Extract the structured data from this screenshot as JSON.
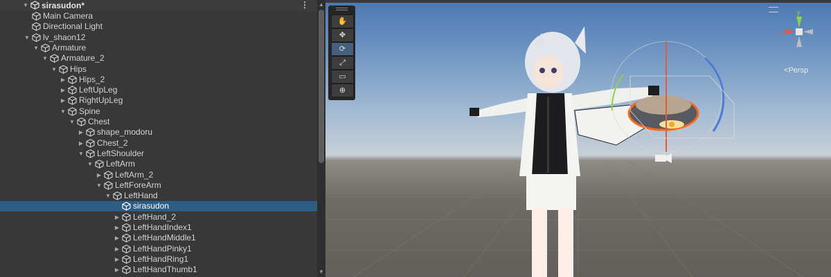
{
  "hierarchy": {
    "scene_name": "sirasudon*",
    "items": [
      {
        "label": "Main Camera",
        "depth": 1,
        "expand": "none"
      },
      {
        "label": "Directional Light",
        "depth": 1,
        "expand": "none"
      },
      {
        "label": "lv_shaon12",
        "depth": 1,
        "expand": "open"
      },
      {
        "label": "Armature",
        "depth": 2,
        "expand": "open"
      },
      {
        "label": "Armature_2",
        "depth": 3,
        "expand": "open"
      },
      {
        "label": "Hips",
        "depth": 4,
        "expand": "open"
      },
      {
        "label": "Hips_2",
        "depth": 5,
        "expand": "closed"
      },
      {
        "label": "LeftUpLeg",
        "depth": 5,
        "expand": "closed"
      },
      {
        "label": "RightUpLeg",
        "depth": 5,
        "expand": "closed"
      },
      {
        "label": "Spine",
        "depth": 5,
        "expand": "open"
      },
      {
        "label": "Chest",
        "depth": 6,
        "expand": "open"
      },
      {
        "label": "shape_modoru",
        "depth": 7,
        "expand": "closed"
      },
      {
        "label": "Chest_2",
        "depth": 7,
        "expand": "closed"
      },
      {
        "label": "LeftShoulder",
        "depth": 7,
        "expand": "open"
      },
      {
        "label": "LeftArm",
        "depth": 8,
        "expand": "open"
      },
      {
        "label": "LeftArm_2",
        "depth": 9,
        "expand": "closed"
      },
      {
        "label": "LeftForeArm",
        "depth": 9,
        "expand": "open"
      },
      {
        "label": "LeftHand",
        "depth": 10,
        "expand": "open"
      },
      {
        "label": "sirasudon",
        "depth": 11,
        "expand": "none",
        "selected": true
      },
      {
        "label": "LeftHand_2",
        "depth": 11,
        "expand": "closed"
      },
      {
        "label": "LeftHandIndex1",
        "depth": 11,
        "expand": "closed"
      },
      {
        "label": "LeftHandMiddle1",
        "depth": 11,
        "expand": "closed"
      },
      {
        "label": "LeftHandPinky1",
        "depth": 11,
        "expand": "closed"
      },
      {
        "label": "LeftHandRing1",
        "depth": 11,
        "expand": "closed"
      },
      {
        "label": "LeftHandThumb1",
        "depth": 11,
        "expand": "closed"
      }
    ]
  },
  "scene_view": {
    "projection_label": "Persp",
    "gizmo_axes": {
      "y": "y",
      "x": "x"
    },
    "tools": [
      {
        "icon": "hand-icon",
        "glyph": "✋",
        "active": false
      },
      {
        "icon": "move-icon",
        "glyph": "✥",
        "active": false
      },
      {
        "icon": "rotate-icon",
        "glyph": "⟳",
        "active": true
      },
      {
        "icon": "scale-icon",
        "glyph": "⤢",
        "active": false
      },
      {
        "icon": "rect-icon",
        "glyph": "▭",
        "active": false
      },
      {
        "icon": "transform-icon",
        "glyph": "⊕",
        "active": false
      }
    ]
  },
  "colors": {
    "selection": "#2c5d87",
    "panel": "#383838",
    "gizmo_x": "#e8583a",
    "gizmo_y": "#8ad44c",
    "gizmo_z": "#4a7dd8"
  }
}
